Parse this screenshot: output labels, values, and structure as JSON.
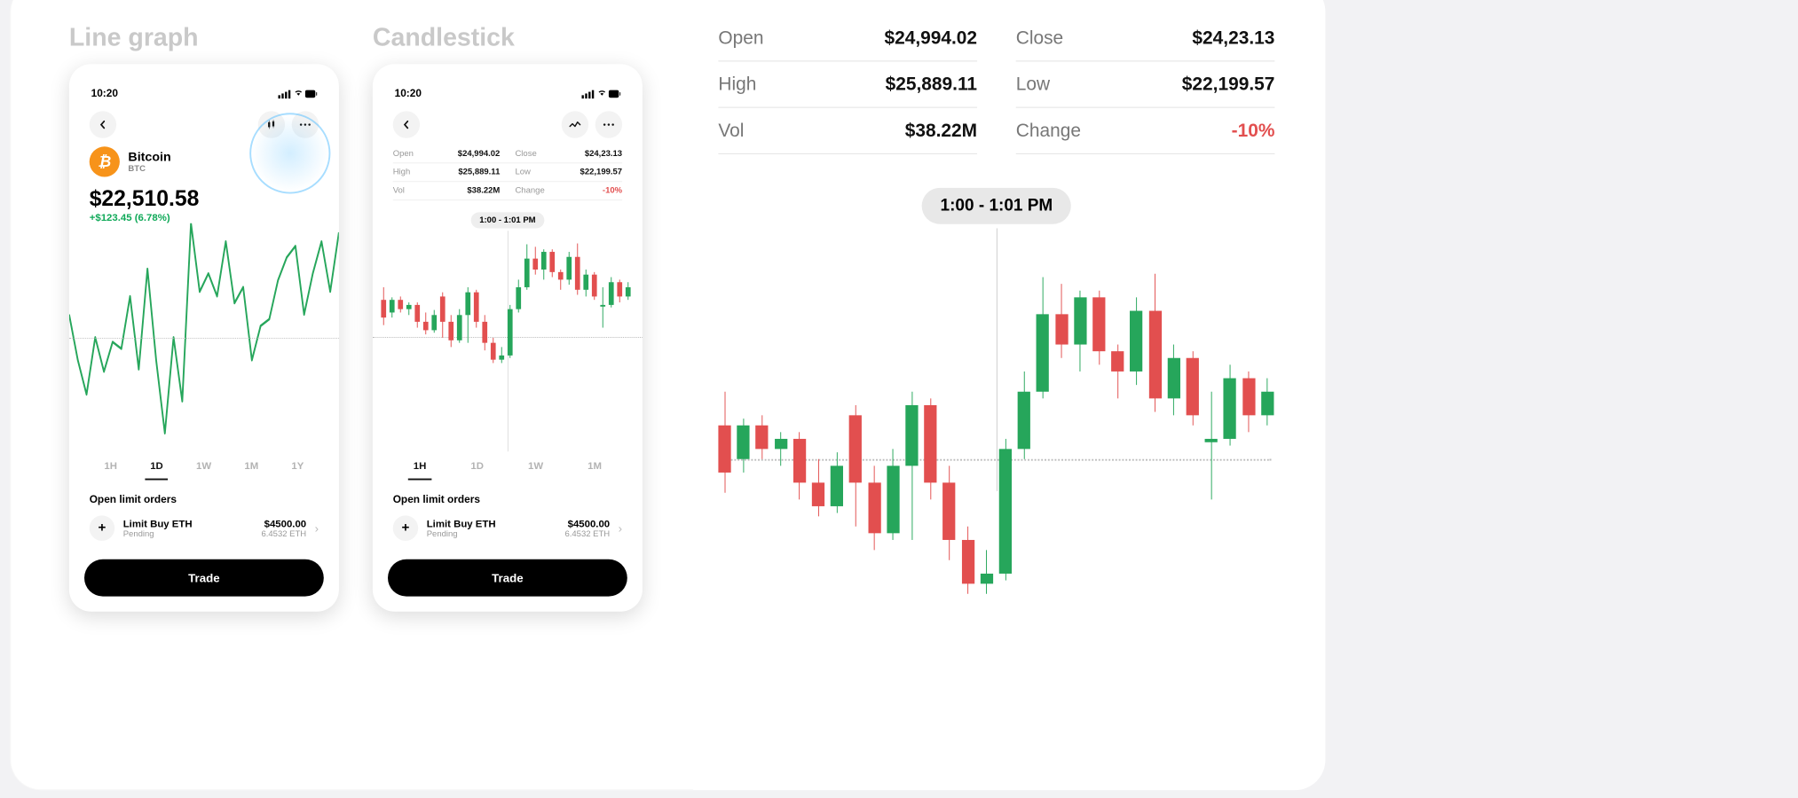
{
  "left_title": "Line graph",
  "right_title": "Candlestick",
  "statusbar_time": "10:20",
  "coin": {
    "name": "Bitcoin",
    "symbol": "BTC",
    "price": "$22,510.58",
    "delta": "+$123.45 (6.78%)"
  },
  "stats": {
    "open_label": "Open",
    "open": "$24,994.02",
    "close_label": "Close",
    "close": "$24,23.13",
    "high_label": "High",
    "high": "$25,889.11",
    "low_label": "Low",
    "low": "$22,199.57",
    "vol_label": "Vol",
    "vol": "$38.22M",
    "change_label": "Change",
    "change": "-10%"
  },
  "time_pill": "1:00 - 1:01 PM",
  "tabs_line": [
    "1H",
    "1D",
    "1W",
    "1M",
    "1Y"
  ],
  "tabs_line_active": "1D",
  "tabs_candle": [
    "1H",
    "1D",
    "1W",
    "1M"
  ],
  "tabs_candle_active": "1H",
  "orders_label": "Open limit orders",
  "order": {
    "title": "Limit Buy ETH",
    "status": "Pending",
    "amount": "$4500.00",
    "qty": "6.4532 ETH"
  },
  "trade_label": "Trade",
  "colors": {
    "up": "#26a65b",
    "down": "#e24f4f"
  },
  "chart_data": [
    {
      "type": "line",
      "title": "BTC 1D price",
      "baseline": 50,
      "series": [
        {
          "name": "BTC",
          "values": [
            60,
            40,
            25,
            50,
            35,
            48,
            45,
            68,
            36,
            80,
            40,
            8,
            50,
            22,
            100,
            70,
            78,
            68,
            92,
            65,
            72,
            40,
            55,
            58,
            75,
            85,
            90,
            60,
            78,
            92,
            70,
            96
          ]
        }
      ]
    },
    {
      "type": "candlestick",
      "title": "BTC 1H candles",
      "baseline": 50,
      "time_label": "1:00 - 1:01 PM",
      "candles": [
        {
          "o": 52,
          "c": 38,
          "h": 62,
          "l": 32
        },
        {
          "o": 42,
          "c": 52,
          "h": 54,
          "l": 38
        },
        {
          "o": 52,
          "c": 45,
          "h": 55,
          "l": 42
        },
        {
          "o": 45,
          "c": 48,
          "h": 50,
          "l": 40
        },
        {
          "o": 48,
          "c": 35,
          "h": 50,
          "l": 30
        },
        {
          "o": 35,
          "c": 28,
          "h": 42,
          "l": 25
        },
        {
          "o": 28,
          "c": 40,
          "h": 44,
          "l": 26
        },
        {
          "o": 55,
          "c": 35,
          "h": 58,
          "l": 22
        },
        {
          "o": 35,
          "c": 20,
          "h": 40,
          "l": 15
        },
        {
          "o": 20,
          "c": 40,
          "h": 45,
          "l": 18
        },
        {
          "o": 40,
          "c": 58,
          "h": 62,
          "l": 18
        },
        {
          "o": 58,
          "c": 35,
          "h": 60,
          "l": 30
        },
        {
          "o": 35,
          "c": 18,
          "h": 40,
          "l": 12
        },
        {
          "o": 18,
          "c": 5,
          "h": 22,
          "l": 2
        },
        {
          "o": 5,
          "c": 8,
          "h": 15,
          "l": 2
        },
        {
          "o": 8,
          "c": 45,
          "h": 48,
          "l": 6
        },
        {
          "o": 45,
          "c": 62,
          "h": 68,
          "l": 42
        },
        {
          "o": 62,
          "c": 85,
          "h": 96,
          "l": 60
        },
        {
          "o": 85,
          "c": 76,
          "h": 94,
          "l": 72
        },
        {
          "o": 76,
          "c": 90,
          "h": 92,
          "l": 68
        },
        {
          "o": 90,
          "c": 74,
          "h": 92,
          "l": 70
        },
        {
          "o": 74,
          "c": 68,
          "h": 76,
          "l": 60
        },
        {
          "o": 68,
          "c": 86,
          "h": 90,
          "l": 64
        },
        {
          "o": 86,
          "c": 60,
          "h": 97,
          "l": 56
        },
        {
          "o": 60,
          "c": 72,
          "h": 76,
          "l": 55
        },
        {
          "o": 72,
          "c": 55,
          "h": 74,
          "l": 52
        },
        {
          "o": 47,
          "c": 48,
          "h": 62,
          "l": 30
        },
        {
          "o": 48,
          "c": 66,
          "h": 70,
          "l": 46
        },
        {
          "o": 66,
          "c": 55,
          "h": 68,
          "l": 50
        },
        {
          "o": 55,
          "c": 62,
          "h": 66,
          "l": 52
        }
      ]
    }
  ]
}
